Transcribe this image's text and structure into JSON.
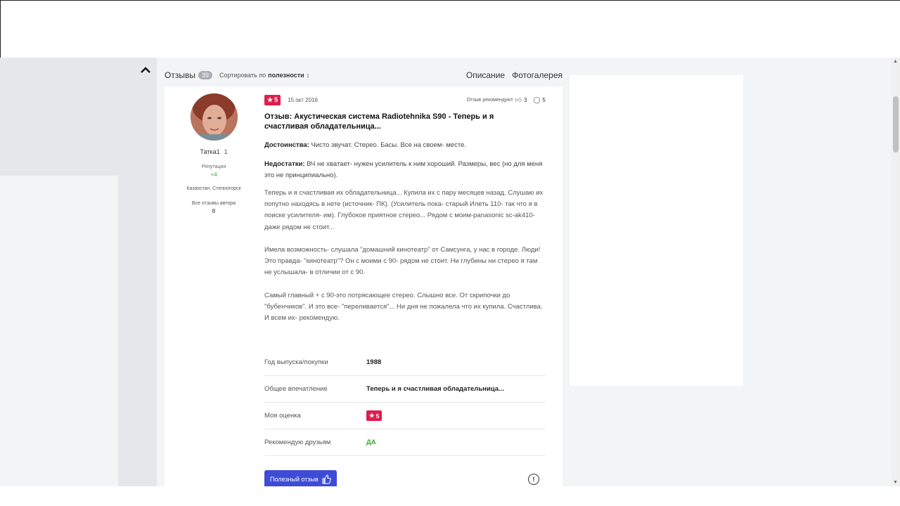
{
  "reviews": {
    "title": "Отзывы",
    "count": "39",
    "sort_label": "Сортировать по",
    "sort_value": "полезности",
    "sort_arrow": "↕",
    "tabs": [
      "Описание",
      "Фотогалерея"
    ]
  },
  "author": {
    "name": "Татка1",
    "level": "1",
    "reputation_label": "Репутация",
    "reputation_value": "+4",
    "location": "Казахстан, Степногорск",
    "all_reviews_label": "Все отзывы автора",
    "all_reviews_count": "8"
  },
  "review": {
    "rating": "5",
    "date": "15 окт 2016",
    "recommend_label": "Отзыв рекомендуют",
    "likes": "3",
    "comments": "5",
    "title": "Отзыв: Акустическая система Radiotehnika S90 - Теперь и я счастливая обладательница...",
    "pros_label": "Достоинства:",
    "pros_text": "Чисто звучат. Стерео. Басы. Все на своем- месте.",
    "cons_label": "Недостатки:",
    "cons_text": "ВЧ не хватает- нужен усилитель к ним хороший. Размеры, вес (но для меня это не принципиально).",
    "paragraphs": [
      "Теперь и я счастливая их обладательница... Купила их с пару месяцев назад. Слушаю их попутно находясь в нете (источник- ПК). (Усилитель пока- старый Илеть 110- так что я в поиске усилителя- им). Глубокое приятное стерео... Рядом с моим-panasonic sc-ak410- даже рядом не стоит...",
      "Имела возможность- слушала \"домашний кинотеатр\" от Самсунга, у нас в городе. Люди! Это правда- \"кинотеатр\"? Он с моими с 90- рядом не стоит. Ни глубины ни стерео я там не услышала- в отличии от с 90.",
      "Самый главный + с 90-это потрясающее стерео. Слышно все. От скрипочки до \"бубенчиков\". И это все- \"переливается\"... Ни дня не пожалела что их купила. Счастлива. И всем их- рекомендую."
    ],
    "specs": [
      {
        "label": "Год выпуска/покупки",
        "value": "1988"
      },
      {
        "label": "Общее впечатление",
        "value": "Теперь и я счастливая обладательница..."
      },
      {
        "label": "Моя оценка",
        "value": "5"
      },
      {
        "label": "Рекомендую друзьям",
        "value": "ДА"
      }
    ],
    "helpful_button": "Полезный отзыв",
    "report_symbol": "!"
  },
  "colors": {
    "rating_badge": "#dc1f4e",
    "button": "#3d4bd6",
    "green": "#3aa335"
  }
}
